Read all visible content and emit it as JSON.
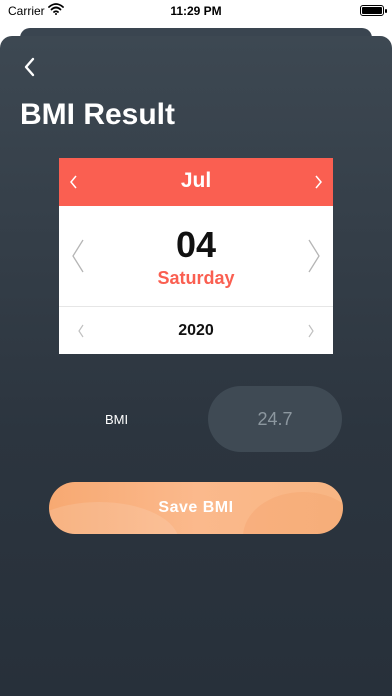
{
  "status_bar": {
    "carrier": "Carrier",
    "time": "11:29 PM",
    "battery_level": 1.0
  },
  "header": {
    "back_icon": "chevron-left-icon",
    "title": "BMI Result"
  },
  "date_picker": {
    "month": "Jul",
    "day": "04",
    "weekday": "Saturday",
    "year": "2020",
    "accent_color": "#fa5f51"
  },
  "bmi": {
    "label": "BMI",
    "value": "24.7"
  },
  "actions": {
    "save_label": "Save BMI"
  },
  "colors": {
    "background_top": "#3d4852",
    "background_bottom": "#27303a",
    "button_gradient_start": "#f7a972",
    "button_gradient_end": "#f8b683"
  }
}
